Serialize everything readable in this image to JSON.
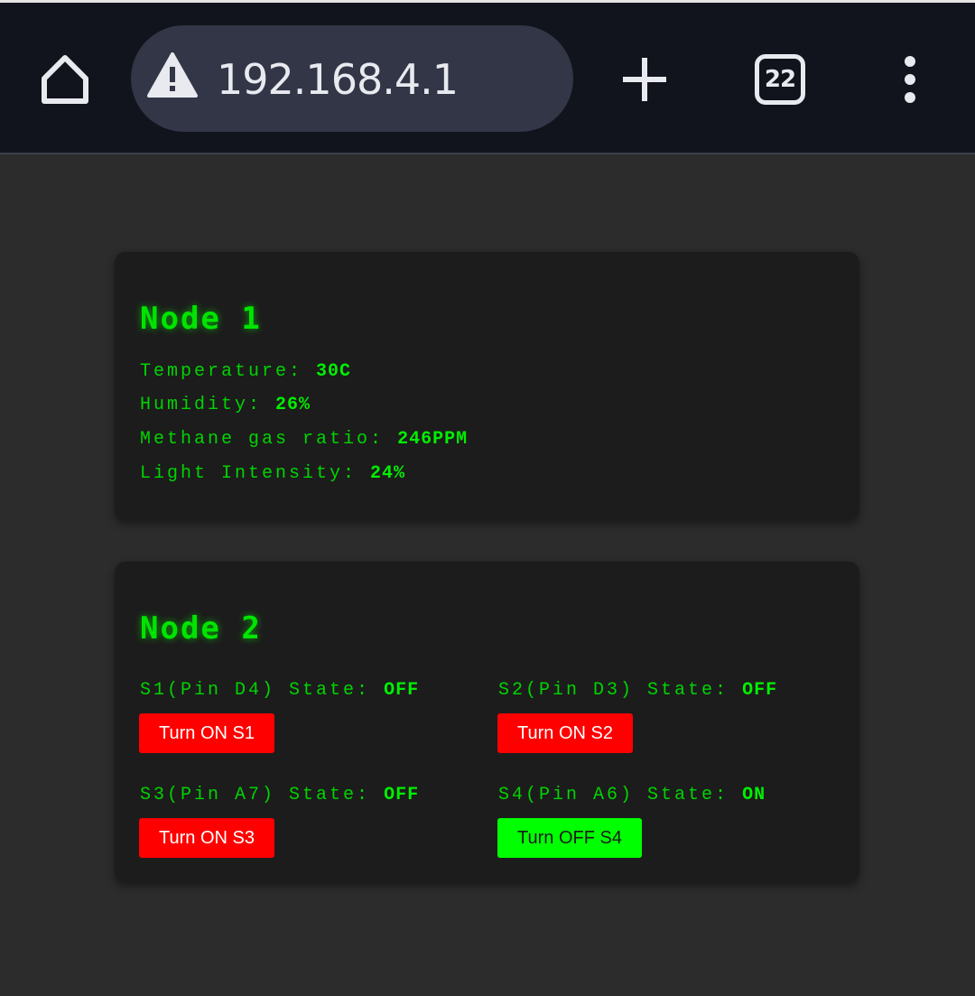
{
  "browser": {
    "url": "192.168.4.1",
    "tab_count": "22",
    "icons": [
      "home-icon",
      "warning-icon",
      "plus-icon",
      "tabs-icon",
      "more-vert-icon"
    ]
  },
  "colors": {
    "page_background": "#2c2c2c",
    "card_background": "#1c1c1c",
    "accent_green": "#00e400",
    "button_red": "#ff0000",
    "button_green": "#00ff00"
  },
  "node1": {
    "title": "Node 1",
    "readings": [
      {
        "label": "Temperature:",
        "value": "30C"
      },
      {
        "label": "Humidity:",
        "value": "26%"
      },
      {
        "label": "Methane gas ratio:",
        "value": "246PPM"
      },
      {
        "label": "Light Intensity:",
        "value": "24%"
      }
    ]
  },
  "node2": {
    "title": "Node 2",
    "switches": [
      {
        "label": "S1(Pin D4) State:",
        "state": "OFF",
        "button": "Turn ON S1"
      },
      {
        "label": "S2(Pin D3) State:",
        "state": "OFF",
        "button": "Turn ON S2"
      },
      {
        "label": "S3(Pin A7) State:",
        "state": "OFF",
        "button": "Turn ON S3"
      },
      {
        "label": "S4(Pin A6) State:",
        "state": "ON",
        "button": "Turn OFF S4"
      }
    ]
  }
}
